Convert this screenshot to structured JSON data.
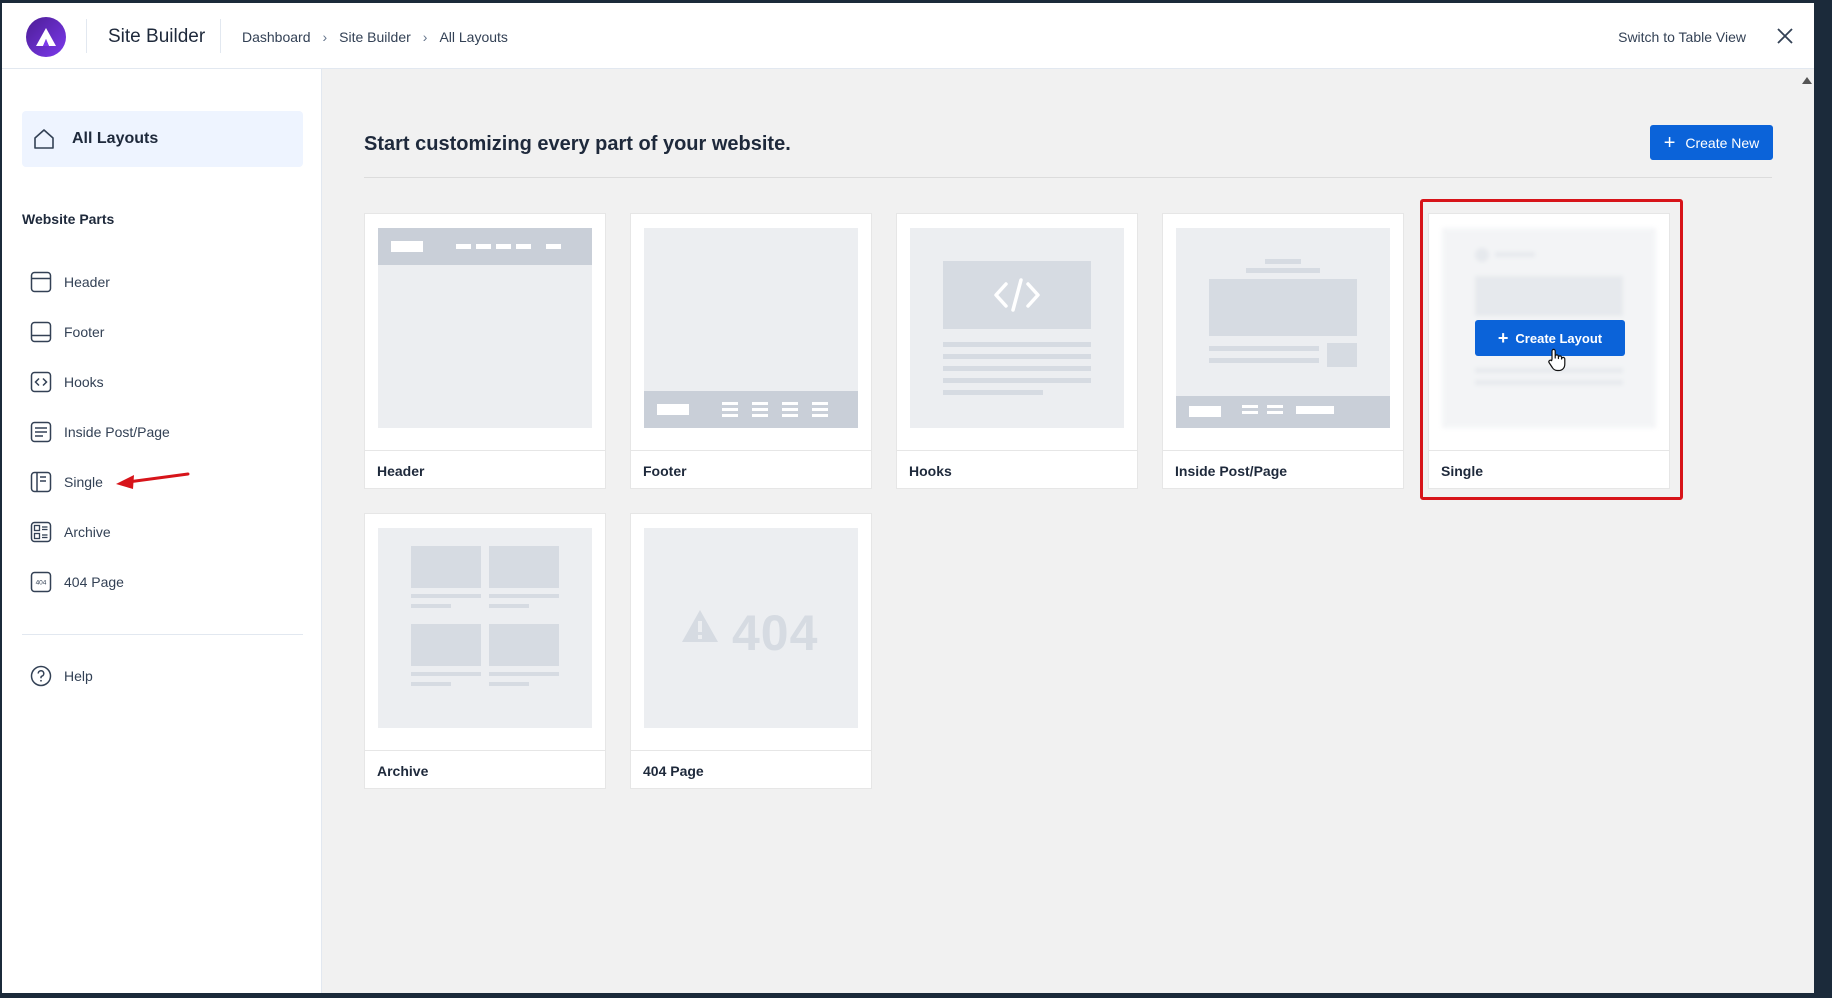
{
  "app": {
    "title": "Site Builder",
    "breadcrumbs": [
      "Dashboard",
      "Site Builder",
      "All Layouts"
    ],
    "switch_view": "Switch to Table View"
  },
  "sidebar": {
    "all_layouts": "All Layouts",
    "section_title": "Website Parts",
    "items": [
      {
        "label": "Header",
        "icon": "header-layout-icon"
      },
      {
        "label": "Footer",
        "icon": "footer-layout-icon"
      },
      {
        "label": "Hooks",
        "icon": "code-icon"
      },
      {
        "label": "Inside Post/Page",
        "icon": "post-content-icon"
      },
      {
        "label": "Single",
        "icon": "single-layout-icon"
      },
      {
        "label": "Archive",
        "icon": "archive-grid-icon"
      },
      {
        "label": "404 Page",
        "icon": "404-page-icon"
      }
    ],
    "help": "Help"
  },
  "main": {
    "title": "Start customizing every part of your website.",
    "create_new": "Create New",
    "create_layout": "Create Layout",
    "cards": [
      {
        "label": "Header"
      },
      {
        "label": "Footer"
      },
      {
        "label": "Hooks"
      },
      {
        "label": "Inside Post/Page"
      },
      {
        "label": "Single"
      },
      {
        "label": "Archive"
      },
      {
        "label": "404 Page"
      }
    ],
    "preview_404_text": "404"
  },
  "colors": {
    "accent": "#0b63d9",
    "highlight": "#d7141a",
    "logo": "#6d28d9"
  }
}
